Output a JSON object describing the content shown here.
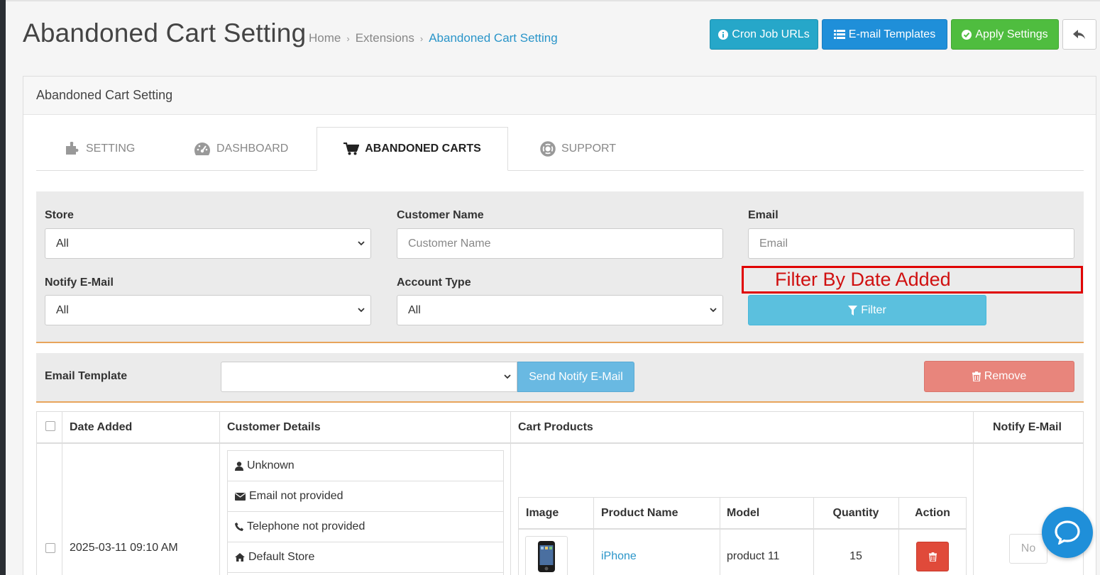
{
  "header": {
    "title": "Abandoned Cart Setting",
    "breadcrumb": [
      "Home",
      "Extensions",
      "Abandoned Cart Setting"
    ],
    "buttons": {
      "cron": "Cron Job URLs",
      "templates": "E-mail Templates",
      "apply": "Apply Settings"
    }
  },
  "panel": {
    "heading": "Abandoned Cart Setting",
    "tabs": [
      {
        "label": "SETTING",
        "icon": "puzzle-icon"
      },
      {
        "label": "DASHBOARD",
        "icon": "dashboard-icon"
      },
      {
        "label": "ABANDONED CARTS",
        "icon": "shopping-cart-icon",
        "active": true
      },
      {
        "label": "SUPPORT",
        "icon": "life-ring-icon"
      }
    ]
  },
  "filters": {
    "store": {
      "label": "Store",
      "value": "All"
    },
    "customer_name": {
      "label": "Customer Name",
      "placeholder": "Customer Name"
    },
    "email": {
      "label": "Email",
      "placeholder": "Email"
    },
    "notify_email": {
      "label": "Notify E-Mail",
      "value": "All"
    },
    "account_type": {
      "label": "Account Type",
      "value": "All"
    },
    "date_added_annotation": "Filter By Date Added",
    "filter_button": "Filter"
  },
  "email_template": {
    "label": "Email Template",
    "value": "",
    "send_button": "Send Notify E-Mail",
    "remove_button": "Remove"
  },
  "table": {
    "headers": [
      "Date Added",
      "Customer Details",
      "Cart Products",
      "Notify E-Mail"
    ],
    "rows": [
      {
        "date_added": "2025-03-11 09:10 AM",
        "customer": [
          "Unknown",
          "Email not provided",
          "Telephone not provided",
          "Default Store"
        ],
        "products": {
          "headers": [
            "Image",
            "Product Name",
            "Model",
            "Quantity",
            "Action"
          ],
          "items": [
            {
              "name": "iPhone",
              "model": "product 11",
              "quantity": "15"
            }
          ]
        },
        "notify": "No"
      }
    ]
  },
  "colors": {
    "info": "#26a7c9",
    "primary": "#1f8fd9",
    "success": "#4fbd3f",
    "danger": "#e04a3a",
    "annotation": "#e00000"
  }
}
